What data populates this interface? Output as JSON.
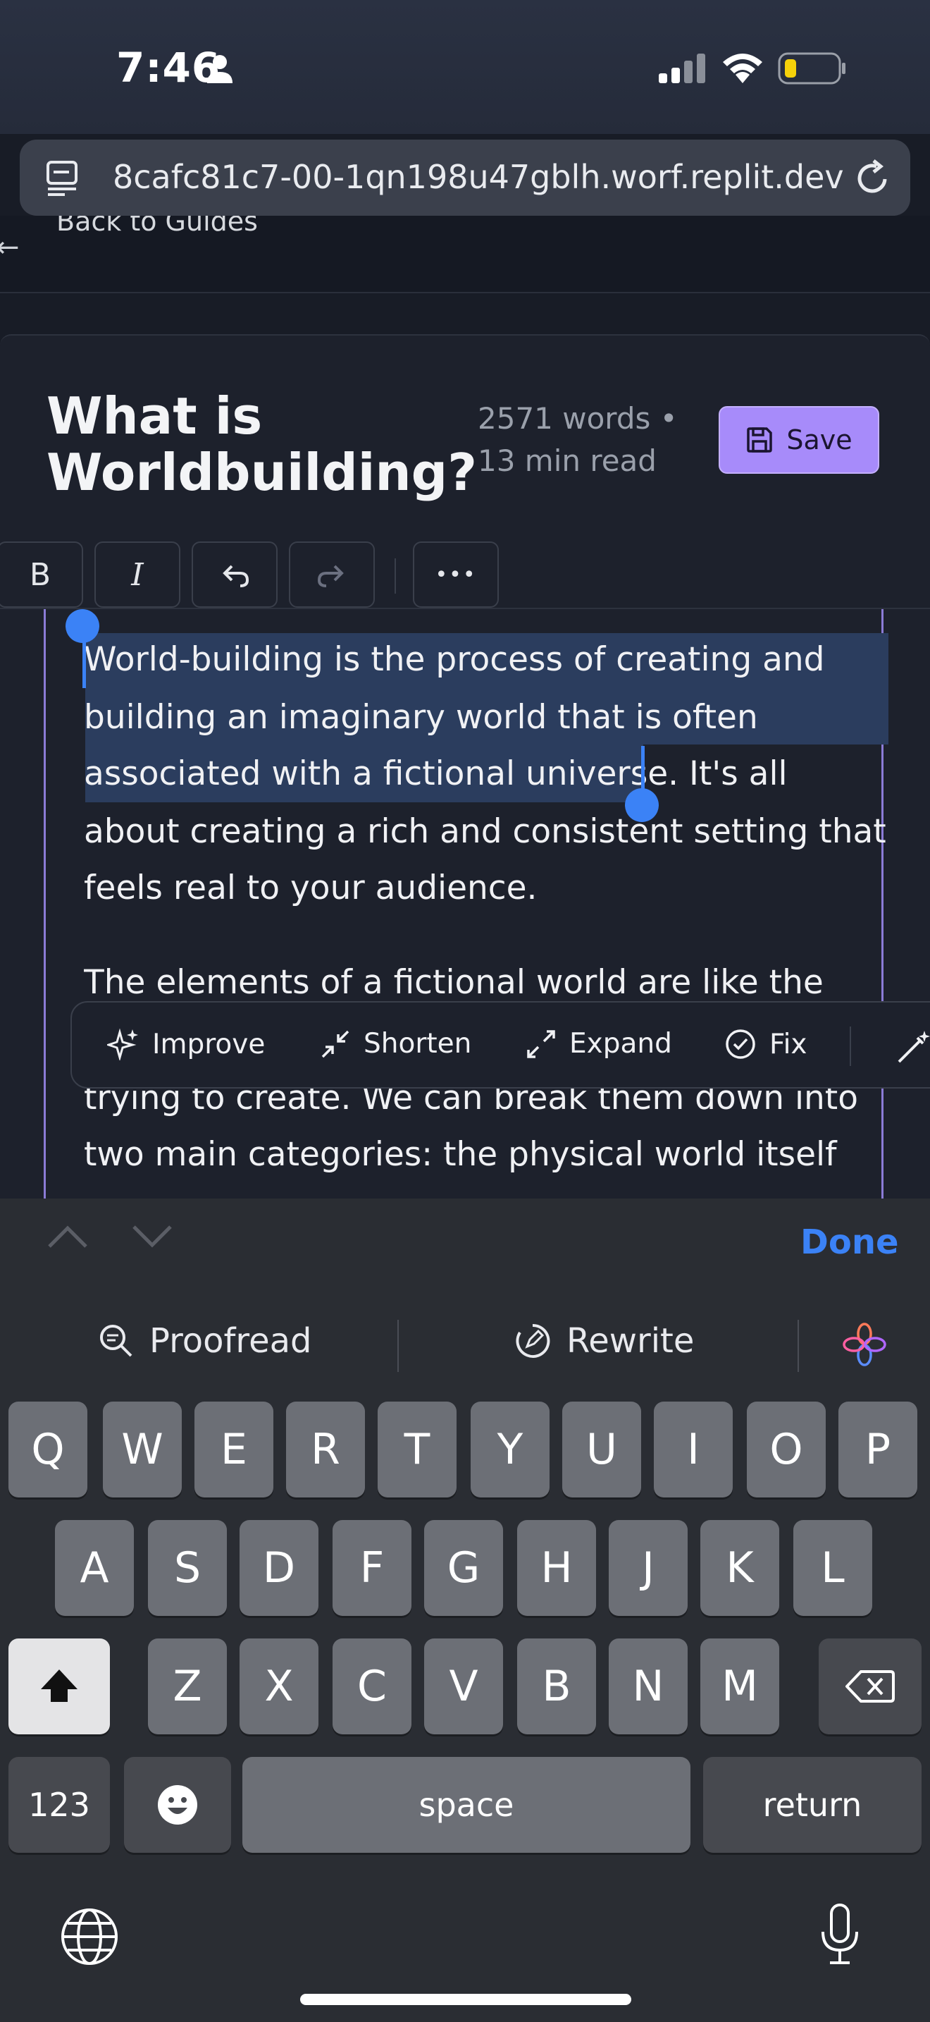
{
  "status_bar": {
    "time": "7:46"
  },
  "browser": {
    "url": "8cafc81c7-00-1qn198u47gblh.worf.replit.dev"
  },
  "app": {
    "back_link": "Back to Guides"
  },
  "editor": {
    "title_line1": "What is",
    "title_line2": "Worldbuilding?",
    "word_count": "2571 words •",
    "read_time": "13 min read",
    "save_label": "Save",
    "toolbar": {
      "bold": "B",
      "italic": "I",
      "more": "•••"
    },
    "paragraph1": [
      "World-building is the process of creating and",
      "building an imaginary world that is often",
      "associated with a fictional universe.",
      " It's all",
      "about creating a rich and consistent setting that",
      "feels real to your audience."
    ],
    "paragraph2": [
      "The elements of a fictional world are like the",
      "trying to create. We can break them down into",
      "two main categories: the physical world itself"
    ]
  },
  "ai_toolbar": {
    "improve": "Improve",
    "shorten": "Shorten",
    "expand": "Expand",
    "fix": "Fix"
  },
  "keyboard": {
    "done": "Done",
    "suggestions": {
      "proofread": "Proofread",
      "rewrite": "Rewrite"
    },
    "row1": [
      "Q",
      "W",
      "E",
      "R",
      "T",
      "Y",
      "U",
      "I",
      "O",
      "P"
    ],
    "row2": [
      "A",
      "S",
      "D",
      "F",
      "G",
      "H",
      "J",
      "K",
      "L"
    ],
    "row3": [
      "Z",
      "X",
      "C",
      "V",
      "B",
      "N",
      "M"
    ],
    "numbers_key": "123",
    "space_key": "space",
    "return_key": "return"
  },
  "colors": {
    "accent_purple": "#a78bfa",
    "selection": "#2b3d5e",
    "handle_blue": "#3b82f6"
  }
}
